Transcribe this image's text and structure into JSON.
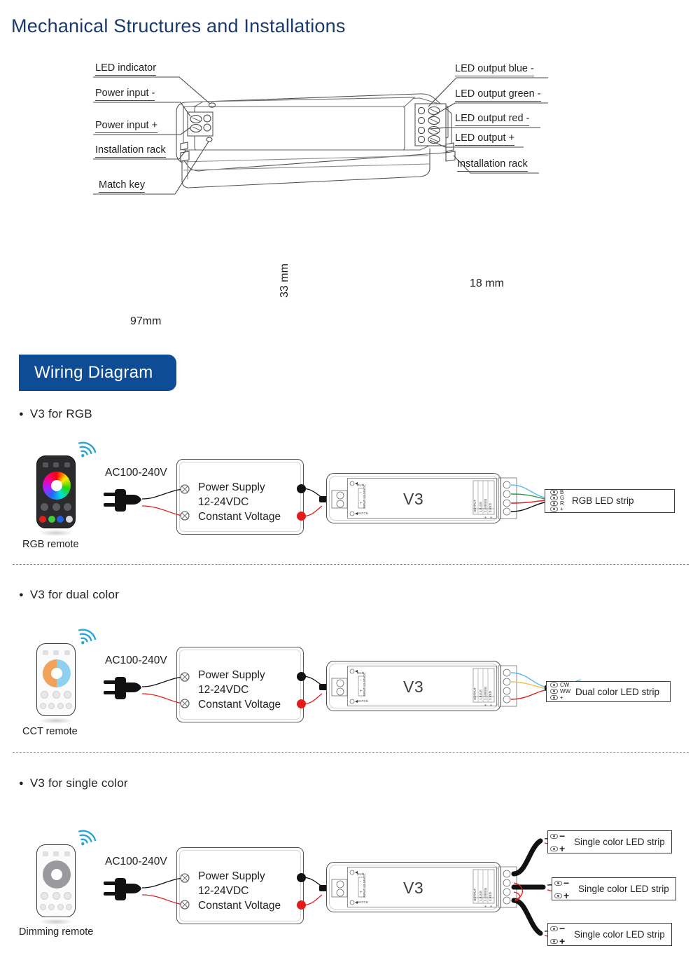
{
  "document": {
    "title": "Mechanical Structures and Installations",
    "section_banner": "Wiring Diagram"
  },
  "mechanical": {
    "callouts_left": [
      {
        "label": "LED indicator"
      },
      {
        "label": "Power input -"
      },
      {
        "label": "Power input +"
      },
      {
        "label": "Installation rack"
      },
      {
        "label": "Match key"
      }
    ],
    "callouts_right": [
      {
        "label": "LED output blue -"
      },
      {
        "label": "LED output green -"
      },
      {
        "label": "LED output red -"
      },
      {
        "label": "LED output +"
      },
      {
        "label": "Installation rack"
      }
    ],
    "dimensions": {
      "length": "97mm",
      "width": "33 mm",
      "height": "18 mm"
    }
  },
  "wiring": {
    "rows": [
      {
        "heading": "V3 for RGB",
        "remote_label": "RGB remote",
        "remote_type": "rgb",
        "ac_label": "AC100-240V",
        "psu_lines": [
          "Power Supply",
          "12-24VDC",
          "Constant Voltage"
        ],
        "controller_label": "V3",
        "controller_marks": {
          "run": "RUN",
          "match": "MATCH",
          "input": "INPUT 12-24VDC",
          "input_neg": "-",
          "input_pos": "+",
          "output": "OUTPUT",
          "out_cols": [
            "1.BLUE",
            "2.GREEN",
            "3.RED",
            "+",
            "+"
          ]
        },
        "strips": [
          {
            "name": "RGB LED strip",
            "terminals": [
              "B",
              "G",
              "R",
              "+"
            ]
          }
        ]
      },
      {
        "heading": "V3 for dual color",
        "remote_label": "CCT remote",
        "remote_type": "cct",
        "ac_label": "AC100-240V",
        "psu_lines": [
          "Power Supply",
          "12-24VDC",
          "Constant Voltage"
        ],
        "controller_label": "V3",
        "controller_marks": {
          "run": "RUN",
          "match": "MATCH",
          "input": "INPUT 12-24VDC",
          "input_neg": "-",
          "input_pos": "+",
          "output": "OUTPUT",
          "out_cols": [
            "1.BLUE",
            "2.GREEN",
            "3.RED",
            "+",
            "+"
          ]
        },
        "strips": [
          {
            "name": "Dual color LED strip",
            "terminals": [
              "CW",
              "WW",
              "+"
            ]
          }
        ]
      },
      {
        "heading": "V3 for single color",
        "remote_label": "Dimming remote",
        "remote_type": "dimming",
        "ac_label": "AC100-240V",
        "psu_lines": [
          "Power Supply",
          "12-24VDC",
          "Constant Voltage"
        ],
        "controller_label": "V3",
        "controller_marks": {
          "run": "RUN",
          "match": "MATCH",
          "input": "INPUT 12-24VDC",
          "input_neg": "-",
          "input_pos": "+",
          "output": "OUTPUT",
          "out_cols": [
            "1.BLUE",
            "2.GREEN",
            "3.RED",
            "+",
            "+"
          ]
        },
        "strips": [
          {
            "name": "Single color LED strip",
            "terminals": [
              "−",
              "+"
            ]
          },
          {
            "name": "Single color LED strip",
            "terminals": [
              "−",
              "+"
            ]
          },
          {
            "name": "Single color LED strip",
            "terminals": [
              "−",
              "+"
            ]
          }
        ]
      }
    ]
  },
  "colors": {
    "title_blue": "#1b3a6b",
    "banner_blue": "#0f4c96",
    "wifi_blue": "#29a3d9",
    "wire_red": "#e31b1b",
    "wire_black": "#111112",
    "wire_blue": "#5ab7e8",
    "wire_green": "#2f9e52",
    "wire_yellow": "#f0c04a"
  }
}
